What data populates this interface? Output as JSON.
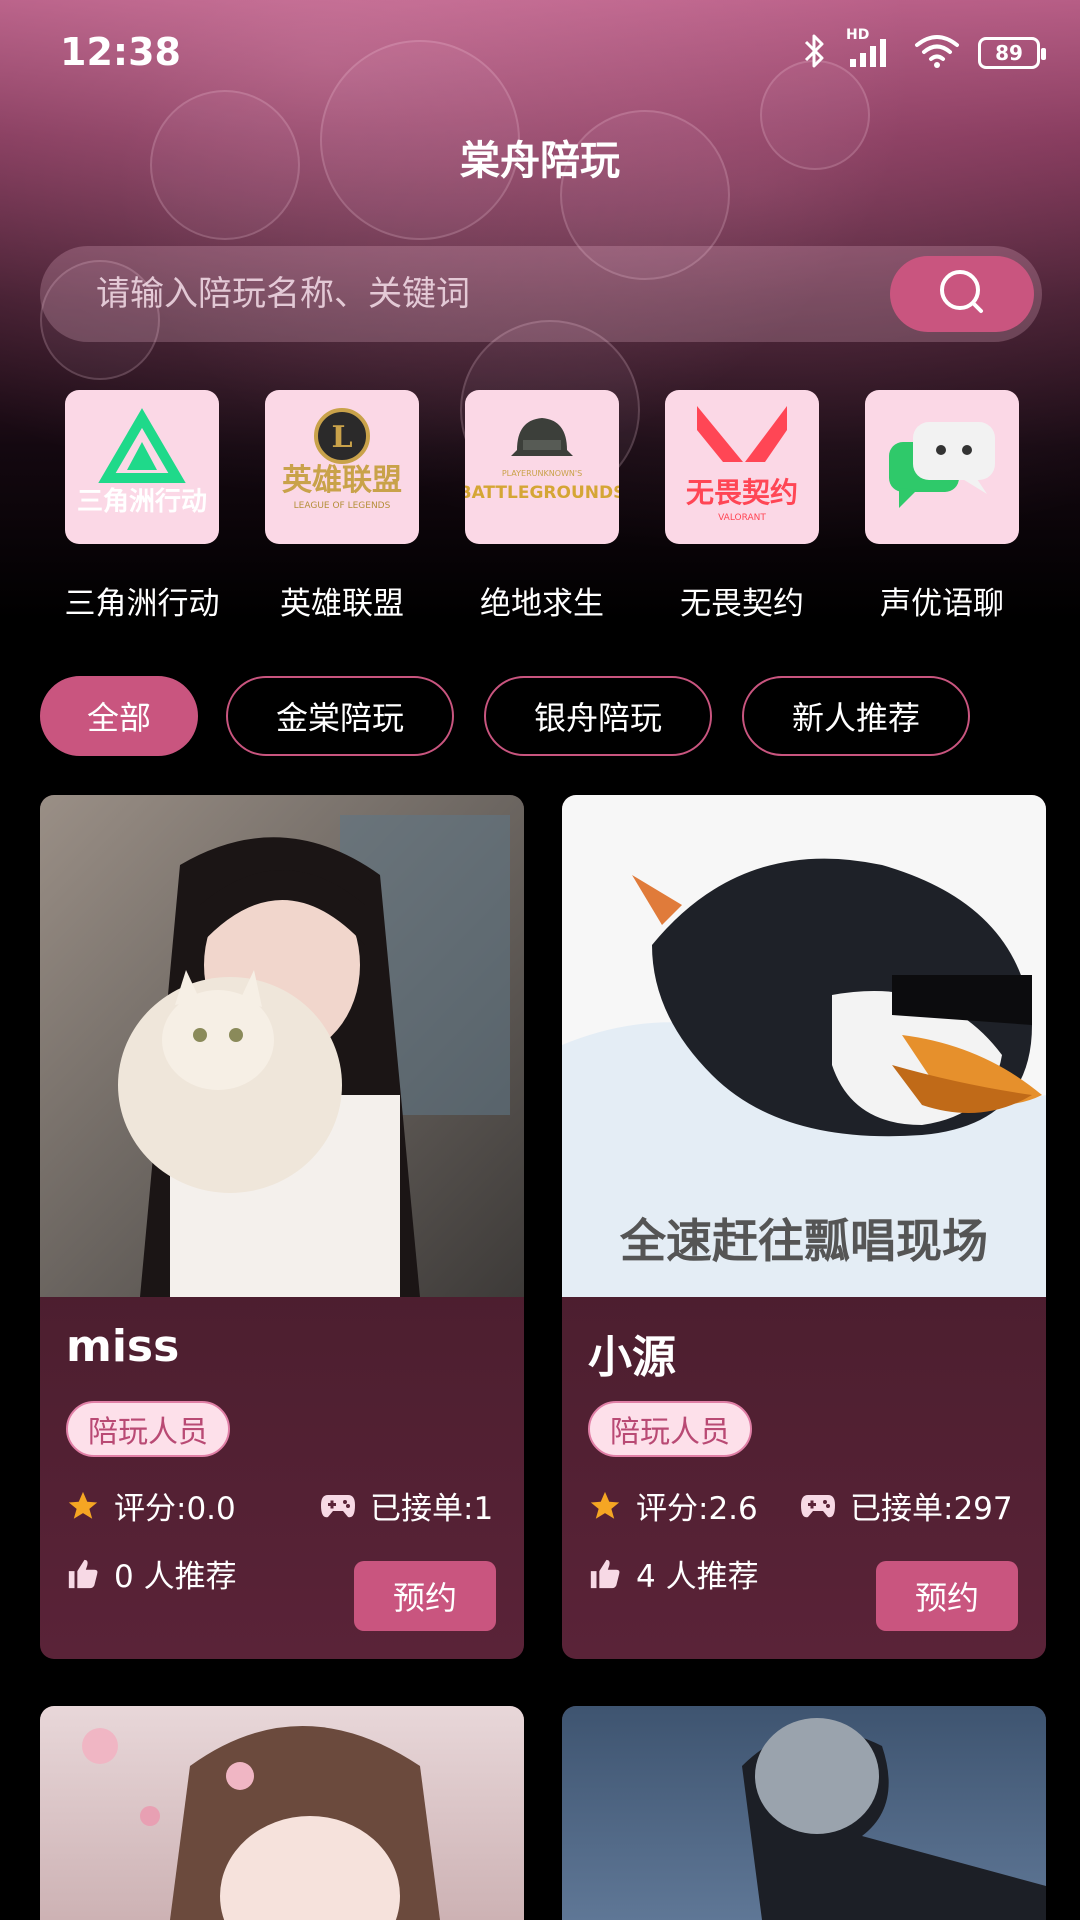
{
  "status_bar": {
    "time": "12:38",
    "network_label": "HD",
    "battery": "89"
  },
  "app": {
    "title": "棠舟陪玩"
  },
  "search": {
    "placeholder": "请输入陪玩名称、关键词"
  },
  "games": [
    {
      "label": "三角洲行动",
      "logo_text": "三角洲行动",
      "icon": "delta-force-logo-icon"
    },
    {
      "label": "英雄联盟",
      "logo_text": "英雄联盟",
      "logo_sub": "LEAGUE OF LEGENDS",
      "icon": "league-of-legends-logo-icon"
    },
    {
      "label": "绝地求生",
      "logo_text": "BATTLEGROUNDS",
      "logo_top": "PLAYERUNKNOWN'S",
      "icon": "pubg-logo-icon"
    },
    {
      "label": "无畏契约",
      "logo_text": "无畏契约",
      "logo_sub": "VALORANT",
      "icon": "valorant-logo-icon"
    },
    {
      "label": "声优语聊",
      "icon": "chat-bubbles-icon"
    }
  ],
  "filters": [
    {
      "label": "全部",
      "active": true
    },
    {
      "label": "金棠陪玩",
      "active": false
    },
    {
      "label": "银舟陪玩",
      "active": false
    },
    {
      "label": "新人推荐",
      "active": false
    }
  ],
  "cards": [
    {
      "name": "miss",
      "tag": "陪玩人员",
      "rating": "评分:0.0",
      "orders": "已接单:1",
      "recommend": "0 人推荐",
      "button": "预约"
    },
    {
      "name": "小源",
      "tag": "陪玩人员",
      "rating": "评分:2.6",
      "orders": "已接单:297",
      "recommend": "4 人推荐",
      "button": "预约",
      "photo_caption": "全速赶往瓢唱现场"
    }
  ],
  "colors": {
    "accent": "#c9557f",
    "tag_bg": "#fde0ea",
    "tag_text": "#b94a74",
    "star": "#f5a623",
    "card_bg": "#4a1e2e"
  }
}
